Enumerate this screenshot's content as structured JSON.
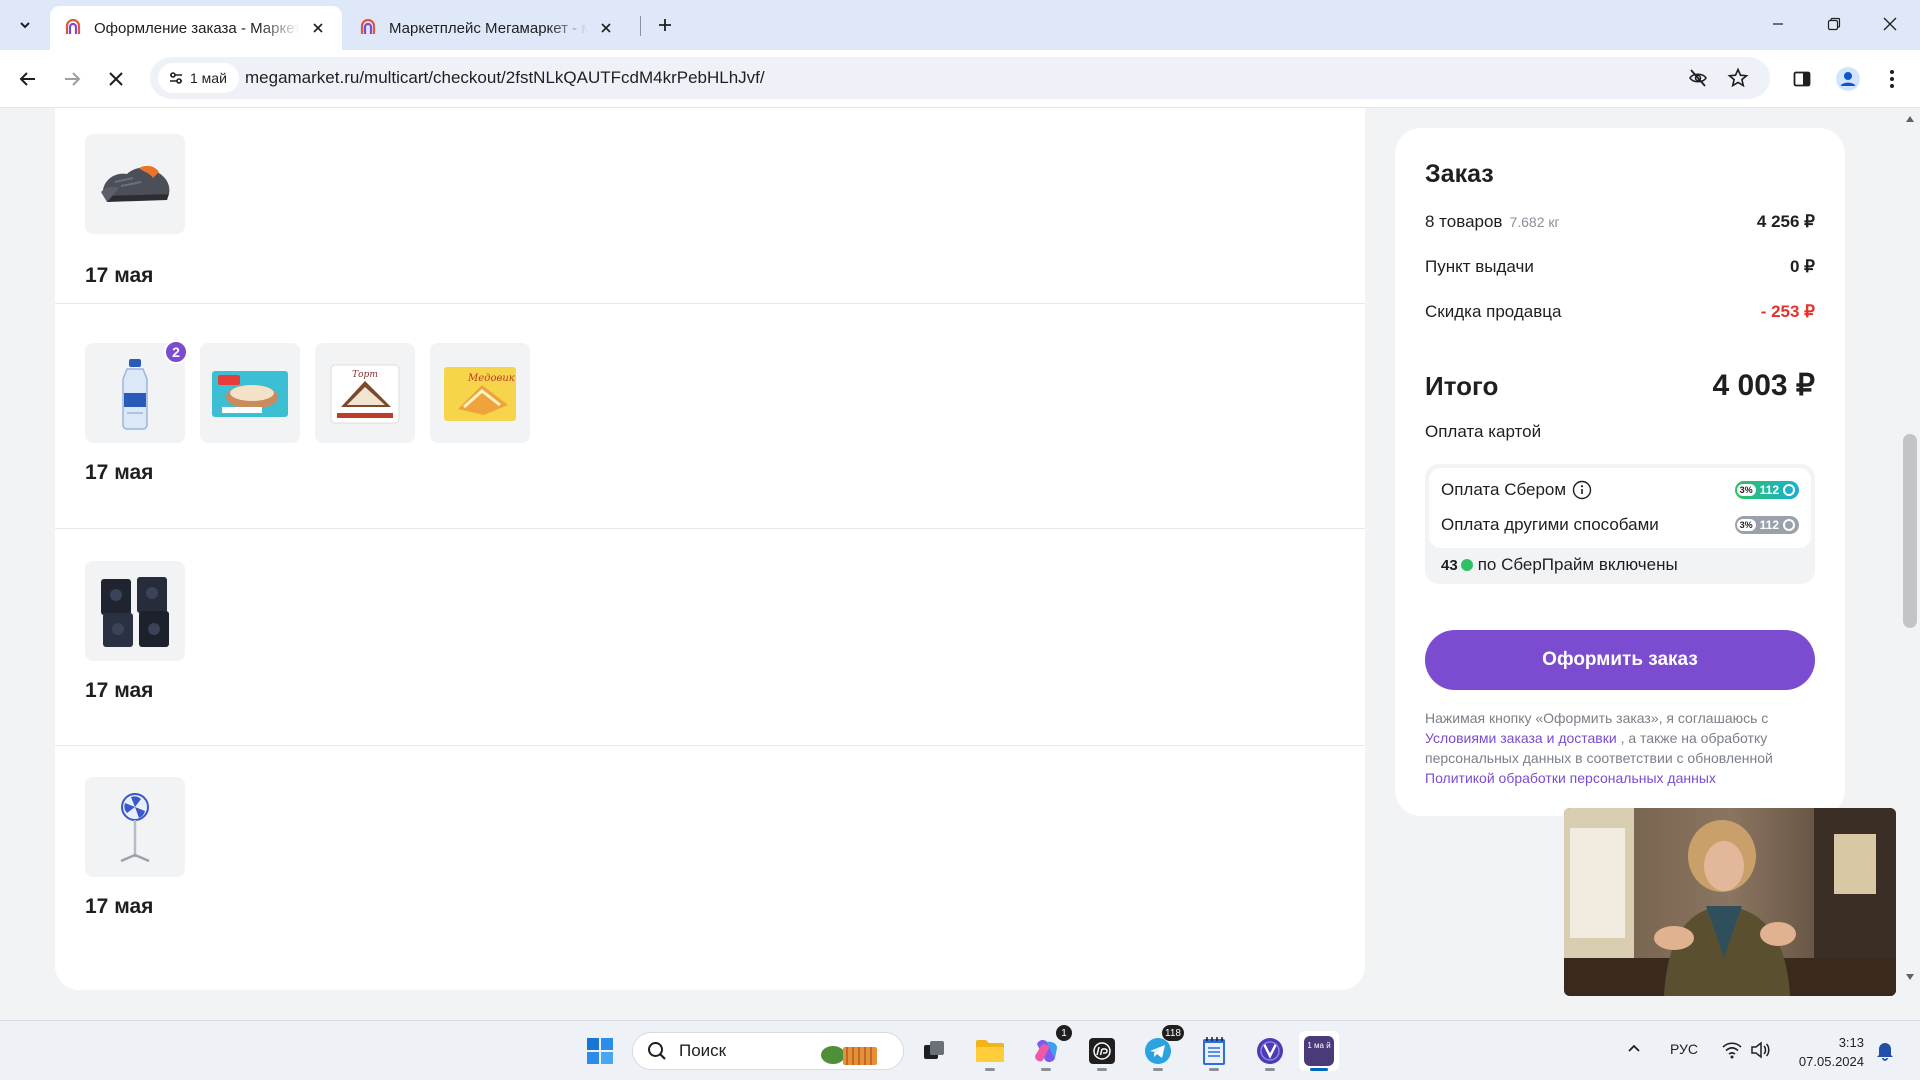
{
  "browser": {
    "tabs": [
      {
        "title": "Оформление заказа - Маркетплейс Мегамаркет",
        "active": true
      },
      {
        "title": "Маркетплейс Мегамаркет - маркетплейс",
        "active": false
      }
    ],
    "site_chip": "1 май",
    "url": "megamarket.ru/multicart/checkout/2fstNLkQAUTFcdM4krPebHLhJvf/"
  },
  "items": {
    "groups": [
      {
        "date": "17 мая",
        "thumbs": [
          "sneakers-image"
        ]
      },
      {
        "date": "17 мая",
        "thumbs": [
          "water-bottle-image",
          "cake-box-image",
          "wafer-cake-image",
          "honey-cake-image"
        ],
        "badge": "2"
      },
      {
        "date": "17 мая",
        "thumbs": [
          "dark-packs-image"
        ]
      },
      {
        "date": "17 мая",
        "thumbs": [
          "standing-fan-image"
        ]
      }
    ]
  },
  "summary": {
    "title": "Заказ",
    "goods_label": "8 товаров",
    "goods_weight": "7.682 кг",
    "goods_value": "4 256 ₽",
    "pickup_label": "Пункт выдачи",
    "pickup_value": "0 ₽",
    "discount_label": "Скидка продавца",
    "discount_value": "- 253 ₽",
    "total_label": "Итого",
    "total_value": "4 003 ₽",
    "payment_method": "Оплата картой",
    "bonus_sber_label": "Оплата Сбером",
    "bonus_sber_pct": "3%",
    "bonus_sber_value": "112",
    "bonus_other_label": "Оплата другими способами",
    "bonus_other_pct": "3%",
    "bonus_other_value": "112",
    "prime_value": "43",
    "prime_text": "по СберПрайм включены",
    "checkout_button": "Оформить заказ",
    "legal_prefix": "Нажимая кнопку «Оформить заказ», я соглашаюсь с",
    "legal_link1": "Условиями заказа и доставки",
    "legal_middle": ", а также на обработку персональных данных в соответствии с обновленной",
    "legal_link2": "Политикой обработки персональных данных",
    "accent_color": "#7b4bd0",
    "discount_color": "#e5312c"
  },
  "taskbar": {
    "search_placeholder": "Поиск",
    "apps": [
      "windows-start",
      "search",
      "task-view",
      "file-explorer",
      "copilot",
      "hp-app",
      "telegram",
      "notepad",
      "proton-vpn",
      "megamarket-app"
    ],
    "copilot_badge": "1",
    "telegram_badge": "118",
    "active_app_label": "1 ма й",
    "language": "РУС",
    "time": "3:13",
    "date": "07.05.2024"
  }
}
